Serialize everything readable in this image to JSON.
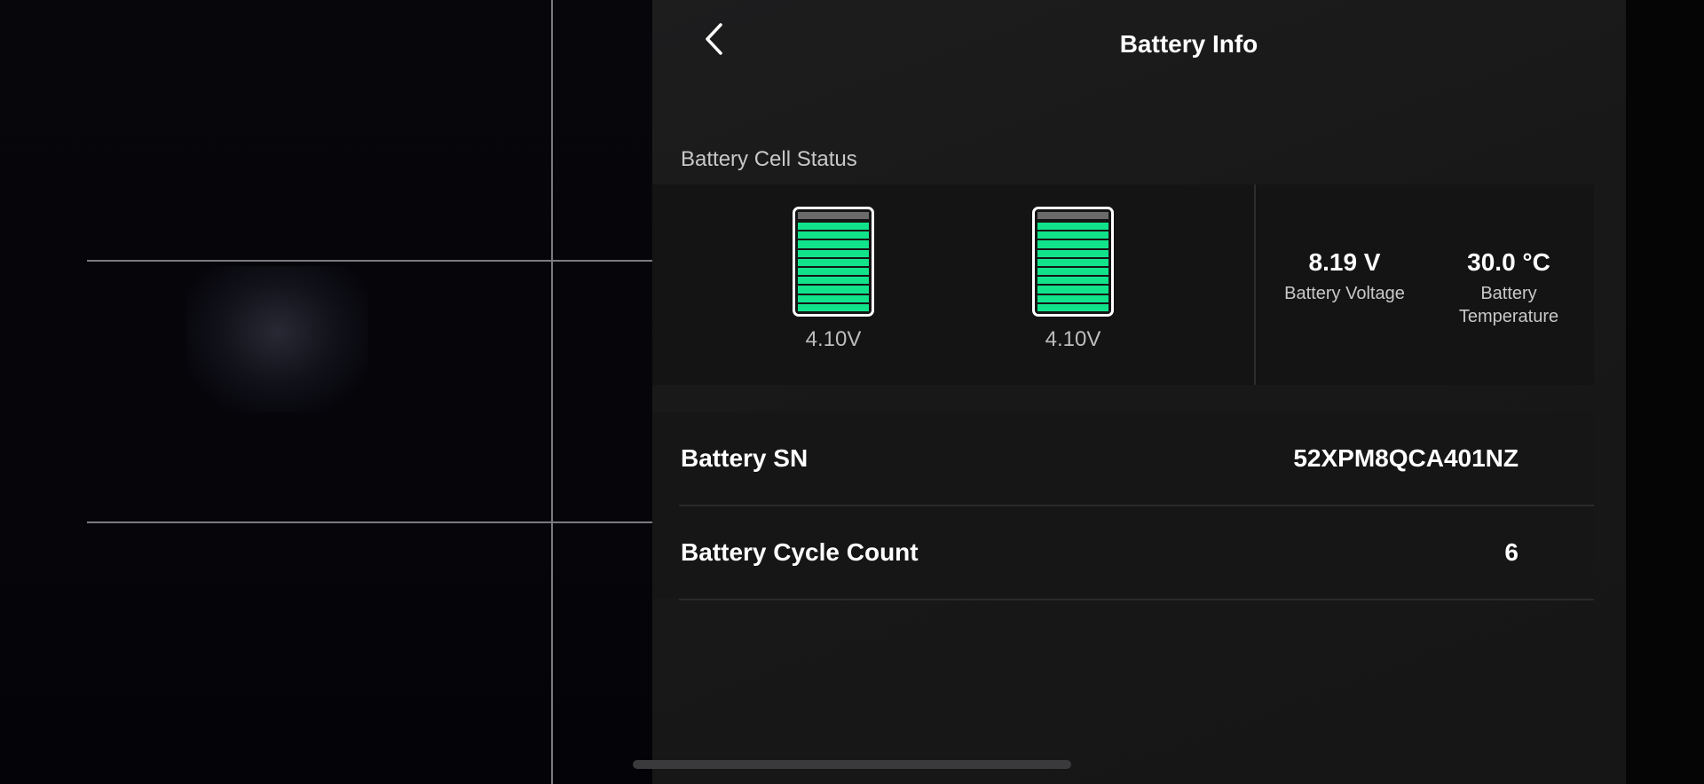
{
  "header": {
    "title": "Battery Info",
    "back_icon": "chevron-left-icon"
  },
  "cell_status": {
    "section_label": "Battery Cell Status",
    "cells": [
      {
        "voltage": "4.10V",
        "charge_fraction": 1.0
      },
      {
        "voltage": "4.10V",
        "charge_fraction": 1.0
      }
    ],
    "battery_color": "#11e38b",
    "voltage": {
      "value": "8.19 V",
      "label": "Battery Voltage"
    },
    "temperature": {
      "value": "30.0 °C",
      "label_line1": "Battery",
      "label_line2": "Temperature"
    }
  },
  "info": {
    "rows": [
      {
        "label": "Battery SN",
        "value": "52XPM8QCA401NZ"
      },
      {
        "label": "Battery Cycle Count",
        "value": "6"
      }
    ]
  }
}
